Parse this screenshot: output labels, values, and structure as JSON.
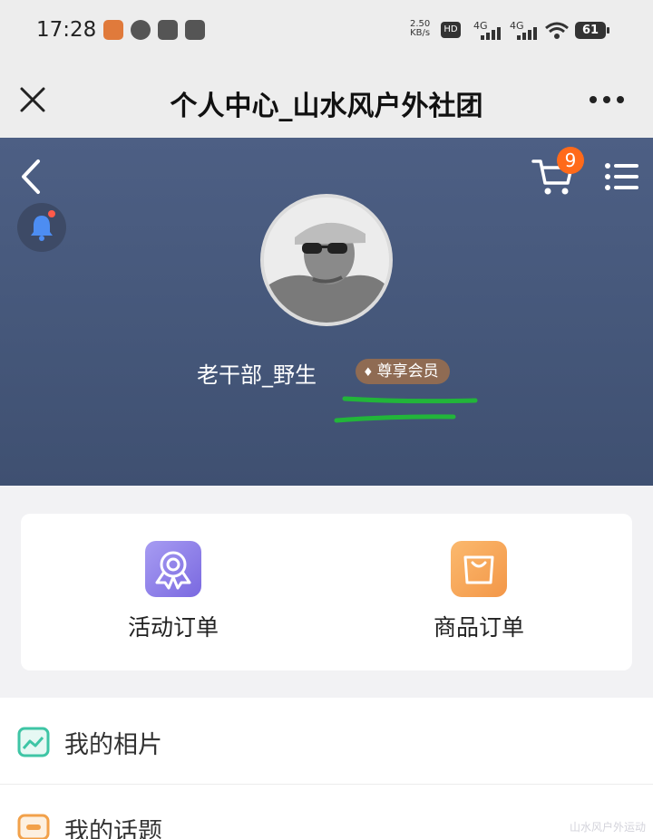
{
  "status_bar": {
    "time": "17:28",
    "net_speed_value": "2.50",
    "net_speed_unit": "KB/s",
    "hd_label": "HD",
    "sim1_label": "4G",
    "sim2_label": "4G",
    "battery_level": "61"
  },
  "titlebar": {
    "title": "个人中心_山水风户外社团"
  },
  "profile": {
    "username": "老干部_野生",
    "member_badge": "尊享会员",
    "cart_count": "9"
  },
  "orders": [
    {
      "label": "活动订单",
      "icon": "award-ribbon-icon",
      "color": "#8a7bea"
    },
    {
      "label": "商品订单",
      "icon": "shopping-bag-icon",
      "color": "#f7a35a"
    }
  ],
  "menu_list": [
    {
      "label": "我的相片",
      "icon": "photo-icon",
      "color": "#3ec5a5"
    },
    {
      "label": "我的话题",
      "icon": "chat-bubble-icon",
      "color": "#f2a14a"
    }
  ],
  "watermark": "山水风户外运动"
}
